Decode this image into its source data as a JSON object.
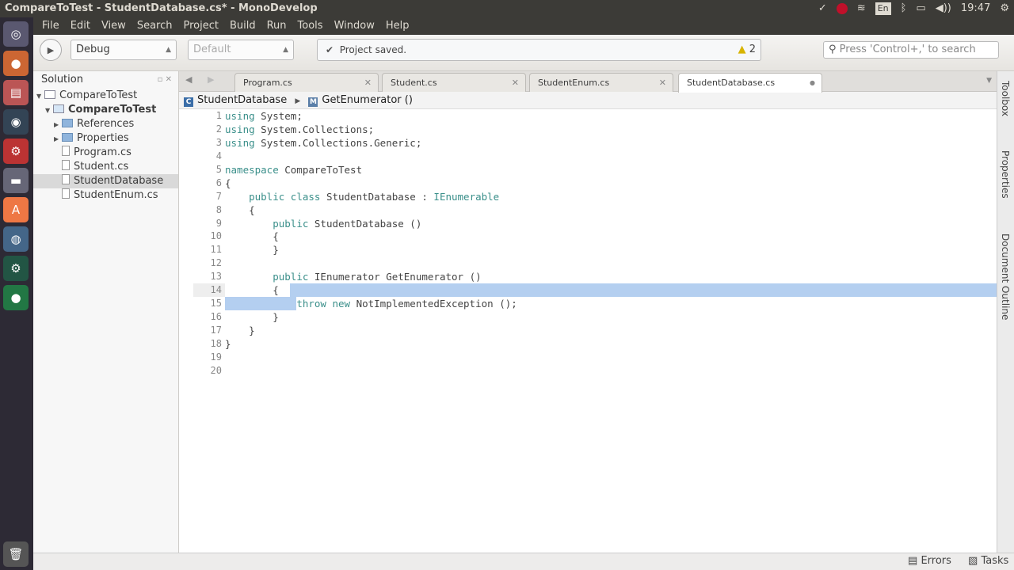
{
  "window": {
    "title": "CompareToTest - StudentDatabase.cs* - MonoDevelop",
    "clock": "19:47",
    "lang": "En"
  },
  "menu": [
    "File",
    "Edit",
    "View",
    "Search",
    "Project",
    "Build",
    "Run",
    "Tools",
    "Window",
    "Help"
  ],
  "toolbar": {
    "config": "Debug",
    "platform": "Default",
    "status": "Project saved.",
    "warnings": "2",
    "search_placeholder": "Press 'Control+,' to search"
  },
  "solution": {
    "title": "Solution",
    "nodes": [
      {
        "label": "CompareToTest",
        "depth": 0,
        "icon": "solution",
        "exp": "▼"
      },
      {
        "label": "CompareToTest",
        "depth": 1,
        "icon": "project",
        "exp": "▼",
        "bold": true
      },
      {
        "label": "References",
        "depth": 2,
        "icon": "folder",
        "exp": "▶"
      },
      {
        "label": "Properties",
        "depth": 2,
        "icon": "folder",
        "exp": "▶"
      },
      {
        "label": "Program.cs",
        "depth": 2,
        "icon": "file"
      },
      {
        "label": "Student.cs",
        "depth": 2,
        "icon": "file"
      },
      {
        "label": "StudentDatabase",
        "depth": 2,
        "icon": "file",
        "selected": true
      },
      {
        "label": "StudentEnum.cs",
        "depth": 2,
        "icon": "file"
      }
    ]
  },
  "tabs": [
    {
      "label": "Program.cs"
    },
    {
      "label": "Student.cs"
    },
    {
      "label": "StudentEnum.cs"
    },
    {
      "label": "StudentDatabase.cs",
      "active": true
    }
  ],
  "breadcrumb": {
    "class": "StudentDatabase",
    "method": "GetEnumerator ()"
  },
  "code": [
    [
      [
        "kw",
        "using"
      ],
      [
        "tx",
        " System;"
      ]
    ],
    [
      [
        "kw",
        "using"
      ],
      [
        "tx",
        " System.Collections;"
      ]
    ],
    [
      [
        "kw",
        "using"
      ],
      [
        "tx",
        " System.Collections.Generic;"
      ]
    ],
    [],
    [
      [
        "kw",
        "namespace"
      ],
      [
        "tx",
        " CompareToTest"
      ]
    ],
    [
      [
        "tx",
        "{"
      ]
    ],
    [
      [
        "tx",
        "    "
      ],
      [
        "kw",
        "public class"
      ],
      [
        "tx",
        " StudentDatabase : "
      ],
      [
        "kw",
        "IEnumerable"
      ]
    ],
    [
      [
        "tx",
        "    {"
      ]
    ],
    [
      [
        "tx",
        "        "
      ],
      [
        "kw",
        "public"
      ],
      [
        "tx",
        " StudentDatabase ()"
      ]
    ],
    [
      [
        "tx",
        "        {"
      ]
    ],
    [
      [
        "tx",
        "        }"
      ]
    ],
    [],
    [
      [
        "tx",
        "        "
      ],
      [
        "kw",
        "public"
      ],
      [
        "tx",
        " IEnumerator GetEnumerator ()"
      ]
    ],
    [
      [
        "tx",
        "        {"
      ]
    ],
    [
      [
        "tx",
        "            "
      ],
      [
        "kw",
        "throw new"
      ],
      [
        "tx",
        " NotImplementedException ();"
      ]
    ],
    [
      [
        "tx",
        "        }"
      ]
    ],
    [
      [
        "tx",
        "    }"
      ]
    ],
    [
      [
        "tx",
        "}"
      ]
    ],
    [],
    []
  ],
  "current_line": 14,
  "side_pads": [
    "Toolbox",
    "Properties",
    "Document Outline"
  ],
  "bottom": {
    "errors": "Errors",
    "tasks": "Tasks"
  }
}
